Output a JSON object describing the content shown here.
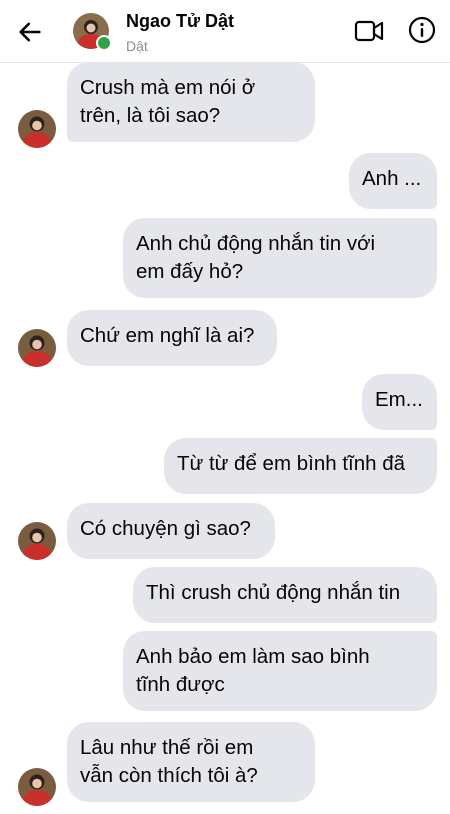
{
  "header": {
    "name": "Ngao Tử Dật",
    "subtitle": "Dật",
    "online_color": "#31a24c"
  },
  "messages": [
    {
      "from": "contact",
      "text_lines": [
        "Crush mà em nói ở",
        "trên, là tôi sao?"
      ]
    },
    {
      "from": "me",
      "text_lines": [
        "Anh ..."
      ]
    },
    {
      "from": "me",
      "text_lines": [
        "Anh chủ động nhắn tin với",
        "em đấy hỏ?"
      ]
    },
    {
      "from": "contact",
      "text_lines": [
        "Chứ em nghĩ là ai?"
      ]
    },
    {
      "from": "me",
      "text_lines": [
        "Em..."
      ]
    },
    {
      "from": "me",
      "text_lines": [
        "Từ từ để em bình tĩnh đã"
      ]
    },
    {
      "from": "contact",
      "text_lines": [
        "Có chuyện gì sao?"
      ]
    },
    {
      "from": "me",
      "text_lines": [
        "Thì crush chủ động nhắn tin"
      ]
    },
    {
      "from": "me",
      "text_lines": [
        "Anh bảo em làm sao bình",
        "tĩnh được"
      ]
    },
    {
      "from": "contact",
      "text_lines": [
        "Lâu như thế rồi em",
        "vẫn còn thích tôi à?"
      ]
    }
  ],
  "icons": {
    "back": "back-arrow-icon",
    "video": "video-call-icon",
    "info": "info-icon"
  },
  "colors": {
    "bubble": "#e4e6eb",
    "text": "#050505",
    "subtitle": "#8a8d91"
  }
}
